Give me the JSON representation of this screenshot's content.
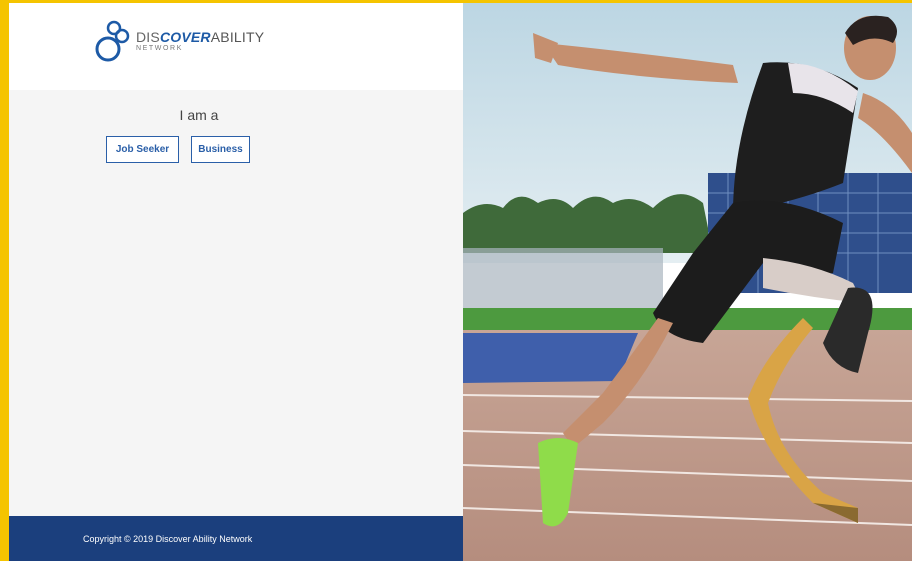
{
  "logo": {
    "prefix": "DIS",
    "emphasis": "COVER",
    "suffix": "ABILITY",
    "subtitle": "NETWORK",
    "icon": "linked-circles-logo-icon"
  },
  "prompt": {
    "label": "I am a"
  },
  "choices": {
    "job_seeker": "Job Seeker",
    "business": "Business"
  },
  "footer": {
    "copyright": "Copyright © 2019 Discover Ability Network"
  },
  "hero": {
    "description_icon": "sprinter-with-prosthetic-leg-photo"
  },
  "colors": {
    "brand_blue": "#1d5aa6",
    "footer_navy": "#1b3f7d",
    "outer_border": "#f5c400"
  }
}
